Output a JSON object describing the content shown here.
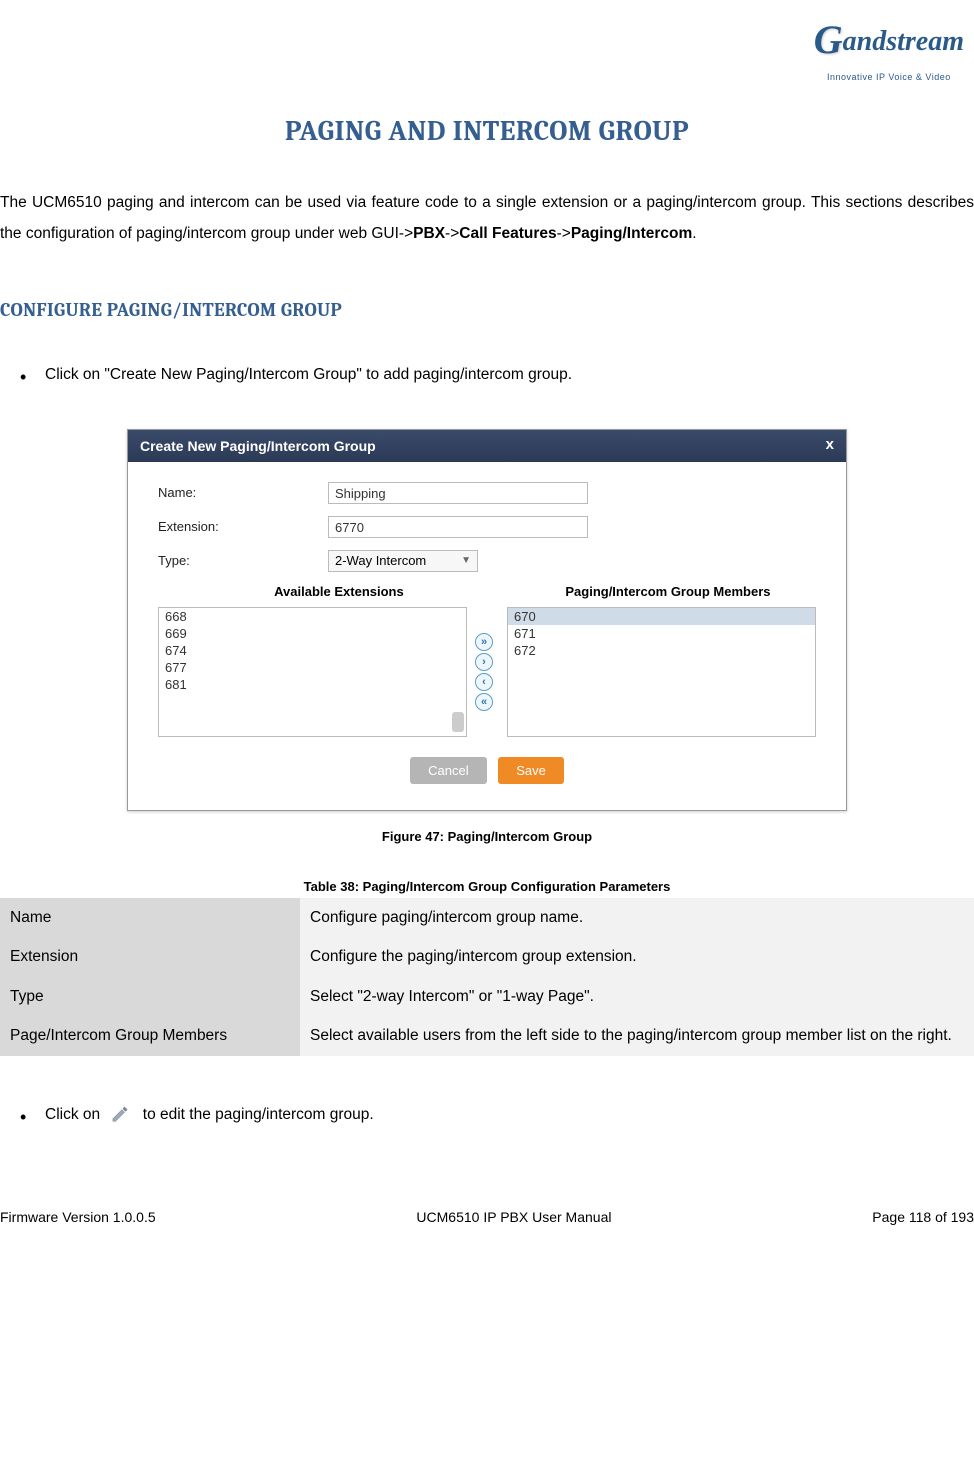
{
  "logo": {
    "main": "andstream",
    "g": "G",
    "sub": "Innovative IP Voice & Video"
  },
  "title": "PAGING AND INTERCOM GROUP",
  "intro": {
    "part1": "The UCM6510 paging and intercom can be used via feature code to a single extension or a paging/intercom group. This sections describes the configuration of paging/intercom group under web GUI->",
    "b1": "PBX",
    "arrow1": "->",
    "b2": "Call Features",
    "arrow2": "->",
    "b3": "Paging/Intercom",
    "end": "."
  },
  "section": "CONFIGURE PAGING/INTERCOM GROUP",
  "bullet1": "Click on \"Create New Paging/Intercom Group\" to add paging/intercom group.",
  "screenshot": {
    "title": "Create New Paging/Intercom Group",
    "close": "x",
    "labels": {
      "name": "Name:",
      "ext": "Extension:",
      "type": "Type:"
    },
    "values": {
      "name": "Shipping",
      "ext": "6770",
      "type": "2-Way Intercom"
    },
    "colhead": {
      "left": "Available Extensions",
      "right": "Paging/Intercom Group Members"
    },
    "available": [
      "668",
      "669",
      "674",
      "677",
      "681"
    ],
    "members": [
      "670",
      "671",
      "672"
    ],
    "btns": {
      "cancel": "Cancel",
      "save": "Save"
    }
  },
  "figcap": "Figure 47: Paging/Intercom Group",
  "tblcap": "Table 38: Paging/Intercom Group Configuration Parameters",
  "table": {
    "rows": [
      {
        "k": "Name",
        "v": "Configure paging/intercom group name."
      },
      {
        "k": "Extension",
        "v": "Configure the paging/intercom group extension."
      },
      {
        "k": "Type",
        "v": "Select \"2-way Intercom\" or \"1-way Page\"."
      },
      {
        "k": "Page/Intercom Group Members",
        "v": "Select available users from the left side to the paging/intercom group member list on the right."
      }
    ]
  },
  "bullet2": {
    "a": "Click on",
    "b": " to edit the paging/intercom group."
  },
  "footer": {
    "left": "Firmware Version 1.0.0.5",
    "center": "UCM6510 IP PBX User Manual",
    "right": "Page 118 of 193"
  }
}
